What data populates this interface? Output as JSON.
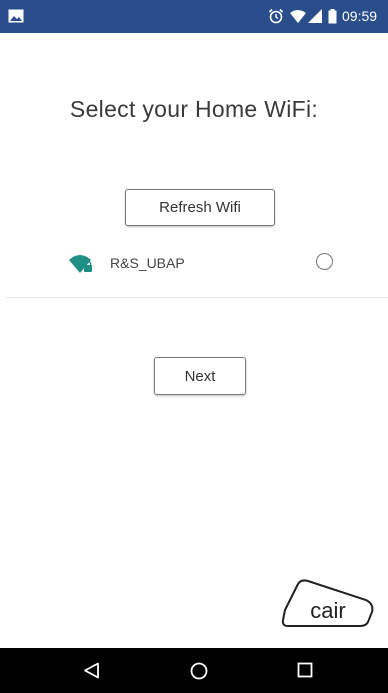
{
  "status_bar": {
    "time": "09:59",
    "icons": [
      "gallery-icon",
      "alarm-icon",
      "wifi-icon",
      "signal-icon",
      "battery-icon"
    ],
    "background_color": "#2a4e8c"
  },
  "main": {
    "title": "Select your Home WiFi:",
    "refresh_label": "Refresh Wifi",
    "networks": [
      {
        "ssid": "R&S_UBAP",
        "selected": false,
        "icon": "wifi-lock-icon",
        "icon_color": "#1f8f86"
      }
    ],
    "next_label": "Next"
  },
  "logo": {
    "text": "cair"
  },
  "nav_bar": {
    "icons": [
      "back-icon",
      "home-icon",
      "recents-icon"
    ]
  }
}
